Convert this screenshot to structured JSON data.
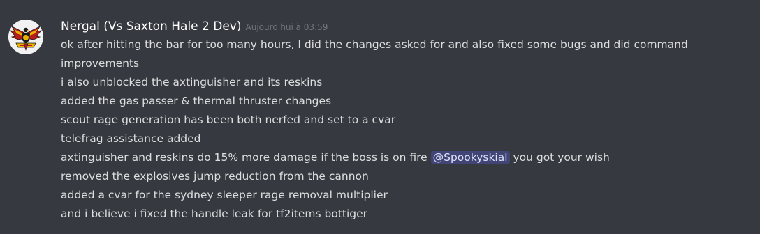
{
  "message": {
    "author": "Nergal (Vs Saxton Hale 2 Dev)",
    "timestamp": "Aujourd'hui à 03:59",
    "lines": [
      "ok after hitting the bar for too many hours, I did the changes asked for and also fixed some bugs and did command",
      "improvements",
      "i also unblocked the axtinguisher and its reskins",
      "added the gas passer & thermal thruster changes",
      "scout rage generation has been both nerfed and set to a  cvar",
      "telefrag assistance added"
    ],
    "mention_line": {
      "before": "axtinguisher and reskins do 15% more damage if the boss is on fire ",
      "mention": "@Spookyskial",
      "after": " you got your wish"
    },
    "lines_after": [
      "removed the explosives jump reduction from the cannon",
      "added a cvar for the sydney sleeper rage removal multiplier",
      "and i believe i fixed the handle leak for tf2items bottiger"
    ]
  },
  "colors": {
    "background": "#36393f",
    "text": "#dcddde",
    "username": "#ffffff",
    "timestamp": "#72767d",
    "mention_text": "#dee0fc",
    "mention_bg": "#5865f2"
  },
  "icons": {
    "avatar": "eagle-emblem-avatar"
  }
}
